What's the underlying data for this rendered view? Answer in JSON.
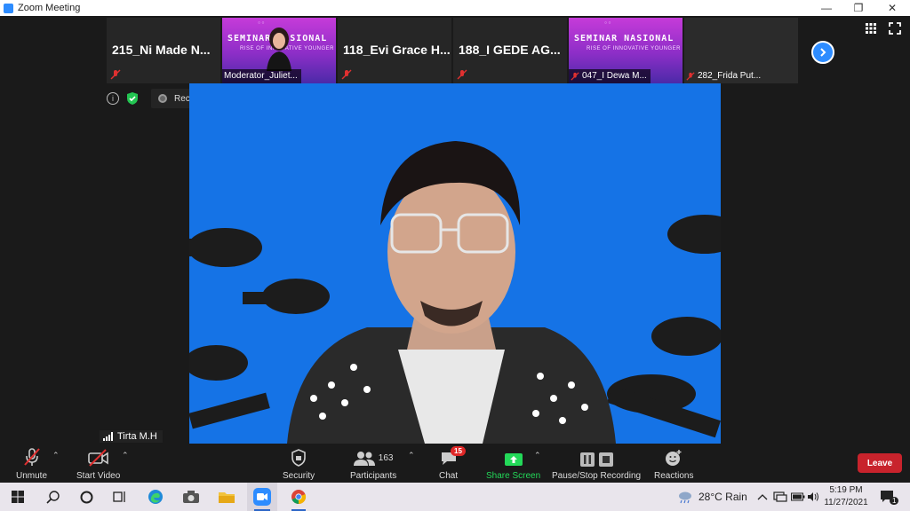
{
  "window": {
    "title": "Zoom Meeting"
  },
  "gallery": {
    "tiles": [
      {
        "name": "215_Ni Made N...",
        "muted": true
      },
      {
        "name": "Moderator_Juliet...",
        "banner_title": "SEMINAR NASIONAL",
        "banner_subtitle": "RISE OF INNOVATIVE YOUNGER",
        "muted": false
      },
      {
        "name": "118_Evi Grace H...",
        "muted": true
      },
      {
        "name": "188_I GEDE AG...",
        "muted": true
      },
      {
        "name": "047_I Dewa M...",
        "banner_title": "SEMINAR NASIONAL",
        "banner_subtitle": "RISE OF INNOVATIVE YOUNGER",
        "muted": true
      },
      {
        "name": "282_Frida Put...",
        "muted": true
      }
    ]
  },
  "recording": {
    "status": "Recording..."
  },
  "speaker": {
    "name": "Tirta M.H"
  },
  "toolbar": {
    "unmute": "Unmute",
    "start_video": "Start Video",
    "security": "Security",
    "participants": "Participants",
    "participants_count": "163",
    "chat": "Chat",
    "chat_badge": "15",
    "share_screen": "Share Screen",
    "pause_stop": "Pause/Stop Recording",
    "reactions": "Reactions",
    "leave": "Leave"
  },
  "taskbar": {
    "weather": "28°C  Rain",
    "time": "5:19 PM",
    "date": "11/27/2021",
    "notifications": "1"
  },
  "colors": {
    "accent": "#2d8cff",
    "share_green": "#23d959",
    "leave_red": "#c8232c",
    "video_bg": "#1573e6"
  }
}
